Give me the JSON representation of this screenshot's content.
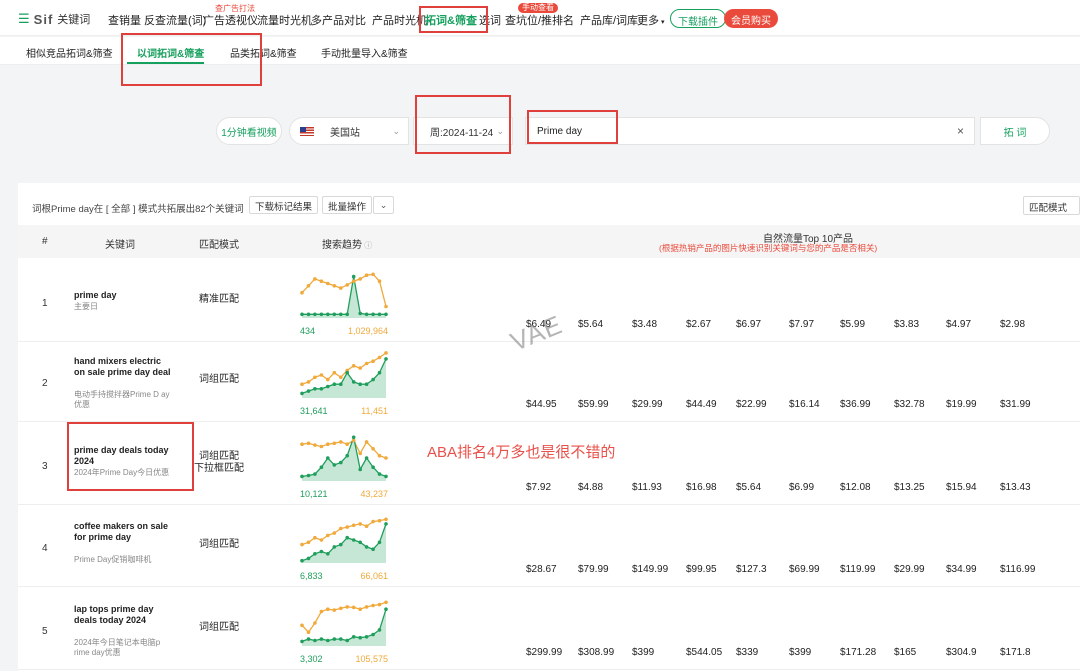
{
  "nav": {
    "brand": "Sif",
    "brand_sub": "关键词",
    "items": [
      {
        "label": "查销量"
      },
      {
        "label": "反查流量(词)"
      },
      {
        "label": "广告透视仪"
      },
      {
        "label": "流量时光机"
      },
      {
        "label": "多产品对比"
      },
      {
        "label": "产品时光机"
      },
      {
        "label": "拓词&筛查"
      },
      {
        "label": "选词"
      },
      {
        "label": "查坑位/推排名"
      },
      {
        "label": "产品库/词库"
      },
      {
        "label": "更多"
      }
    ],
    "tag_ad": "查广告打法",
    "tag_new": "手动查看",
    "download_plugin": "下载插件",
    "member_buy": "会员购买",
    "colors": {
      "accent": "#16a05d",
      "red": "#e94a3b"
    }
  },
  "subtabs": [
    "相似竞品拓词&筛查",
    "以词拓词&筛查",
    "品类拓词&筛查",
    "手动批量导入&筛查"
  ],
  "search": {
    "video_label": "1分钟看视频",
    "market": "美国站",
    "date": "周:2024-11-24",
    "keyword": "Prime day",
    "search_label": "拓 词"
  },
  "results": {
    "summary": "词根Prime day在 [ 全部 ] 模式共拓展出82个关键词",
    "download_btn": "下载标记结果",
    "batch_btn": "批量操作",
    "match_mode": "匹配模式",
    "headers": {
      "num": "#",
      "keyword": "关键词",
      "match": "匹配模式",
      "trend": "搜索趋势",
      "top10": "自然流量Top 10产品",
      "top10_note": "(根据热销产品的图片快速识别关键词与您的产品是否相关)"
    },
    "rows": [
      {
        "n": "1",
        "kw": "prime day",
        "sub": "主要日",
        "mode": "精准匹配",
        "lo": "434",
        "hi": "1,029,964",
        "prices": [
          "$6.49",
          "$5.64",
          "$3.48",
          "$2.67",
          "$6.97",
          "$7.97",
          "$5.99",
          "$3.83",
          "$4.97",
          "$2.98"
        ]
      },
      {
        "n": "2",
        "kw": "hand mixers electric on sale prime day deal",
        "sub": "电动手持搅拌器Prime D ay优惠",
        "mode": "词组匹配",
        "lo": "31,641",
        "hi": "11,451",
        "prices": [
          "$44.95",
          "$59.99",
          "$29.99",
          "$44.49",
          "$22.99",
          "$16.14",
          "$36.99",
          "$32.78",
          "$19.99",
          "$31.99"
        ]
      },
      {
        "n": "3",
        "kw": "prime day deals today 2024",
        "sub": "2024年Prime Day今日优惠",
        "mode": "词组匹配",
        "mode2": "下拉框匹配",
        "lo": "10,121",
        "hi": "43,237",
        "prices": [
          "$7.92",
          "$4.88",
          "$11.93",
          "$16.98",
          "$5.64",
          "$6.99",
          "$12.08",
          "$13.25",
          "$15.94",
          "$13.43"
        ]
      },
      {
        "n": "4",
        "kw": "coffee makers on sale for prime day",
        "sub": "Prime Day促销咖啡机",
        "mode": "词组匹配",
        "lo": "6,833",
        "hi": "66,061",
        "prices": [
          "$28.67",
          "$79.99",
          "$149.99",
          "$99.95",
          "$127.3",
          "$69.99",
          "$119.99",
          "$29.99",
          "$34.99",
          "$116.99"
        ]
      },
      {
        "n": "5",
        "kw": "lap tops prime day deals today 2024",
        "sub": "2024年今日笔记本电脑p rime day优惠",
        "mode": "词组匹配",
        "lo": "3,302",
        "hi": "105,575",
        "prices": [
          "$299.99",
          "$308.99",
          "$399",
          "$544.05",
          "$339",
          "$399",
          "$171.28",
          "$165",
          "$304.9",
          "$171.8"
        ]
      }
    ]
  },
  "watermark": "VAE",
  "annotation": "ABA排名4万多也是很不错的",
  "chart_colors": {
    "search": "#f0a93a",
    "rank": "#1f9e5c"
  }
}
